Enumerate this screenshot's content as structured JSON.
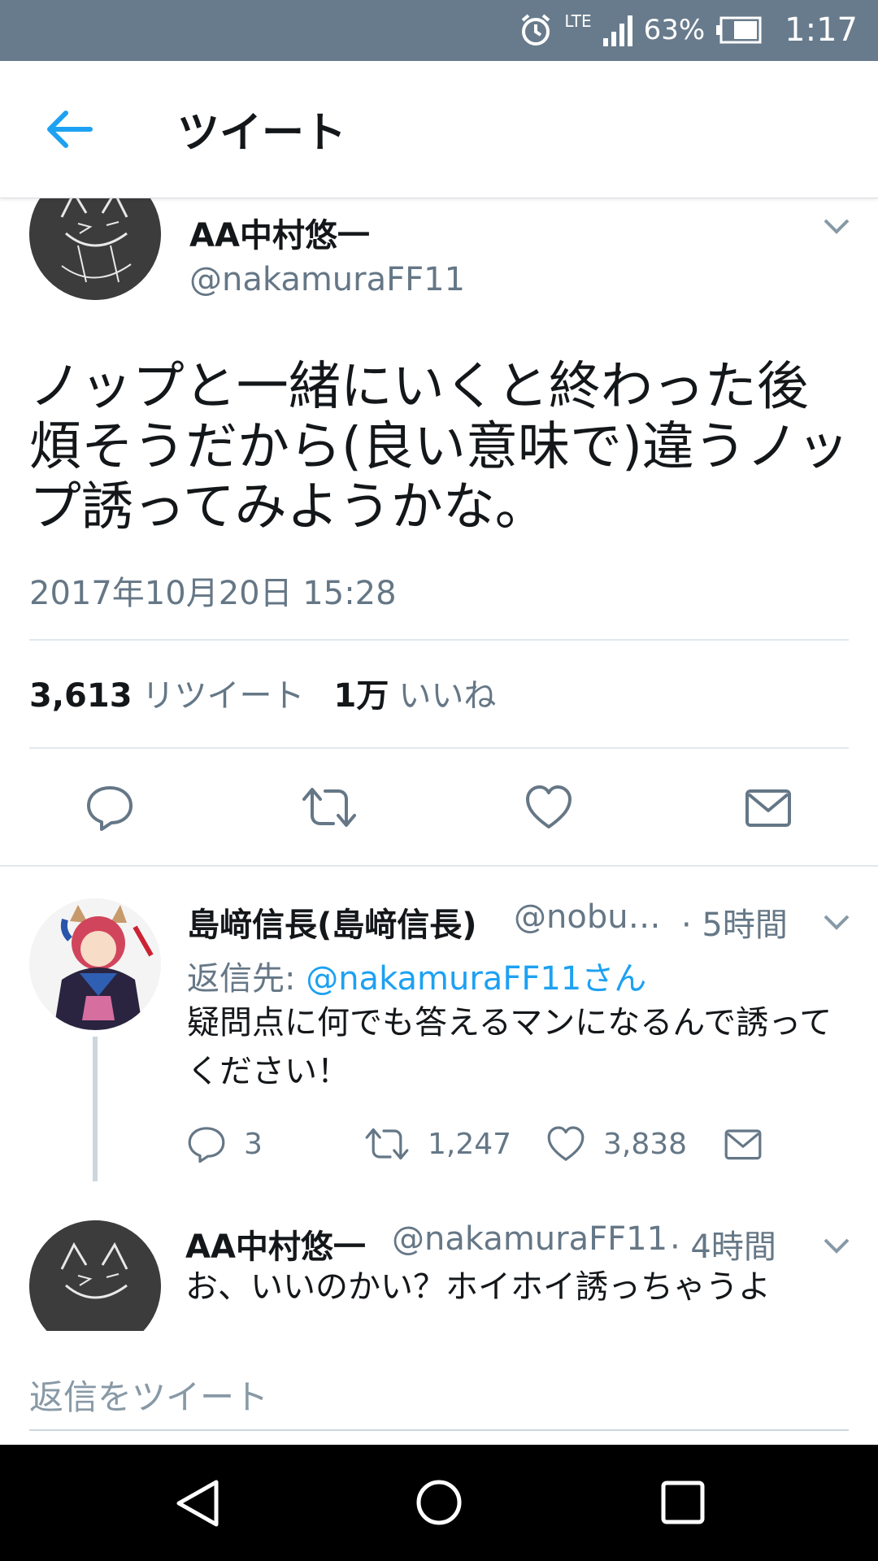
{
  "status_bar": {
    "network": "LTE",
    "battery": "63%",
    "time": "1:17"
  },
  "header": {
    "title": "ツイート"
  },
  "main_tweet": {
    "name": "AA中村悠一",
    "handle": "@nakamuraFF11",
    "text": "ノップと一緒にいくと終わった後煩そうだから(良い意味で)違うノップ誘ってみようかな。",
    "timestamp": "2017年10月20日 15:28",
    "retweet_count": "3,613",
    "retweet_label": "リツイート",
    "like_count": "1万",
    "like_label": "いいね"
  },
  "replies": [
    {
      "name": "島﨑信長(島﨑信長)",
      "handle": "@nobu…",
      "time": "· 5時間",
      "reply_to_label": "返信先:",
      "reply_to_user": "@nakamuraFF11さん",
      "text": "疑問点に何でも答えるマンになるんで誘ってください！",
      "reply_count": "3",
      "retweet_count": "1,247",
      "like_count": "3,838"
    },
    {
      "name": "AA中村悠一",
      "handle": "@nakamuraFF11",
      "time": "· 4時間",
      "text": "お、いいのかい？ホイホイ誘っちゃうよ"
    }
  ],
  "compose": {
    "placeholder": "返信をツイート"
  },
  "icons": {
    "back": "arrow-left-icon",
    "chevron": "chevron-down-icon",
    "reply": "reply-icon",
    "retweet": "retweet-icon",
    "like": "heart-icon",
    "dm": "envelope-icon",
    "nav_back": "triangle-back-icon",
    "nav_home": "circle-home-icon",
    "nav_recents": "square-recents-icon"
  },
  "colors": {
    "accent": "#1da1f2",
    "status_bar": "#687b8c",
    "secondary_text": "#657786"
  }
}
